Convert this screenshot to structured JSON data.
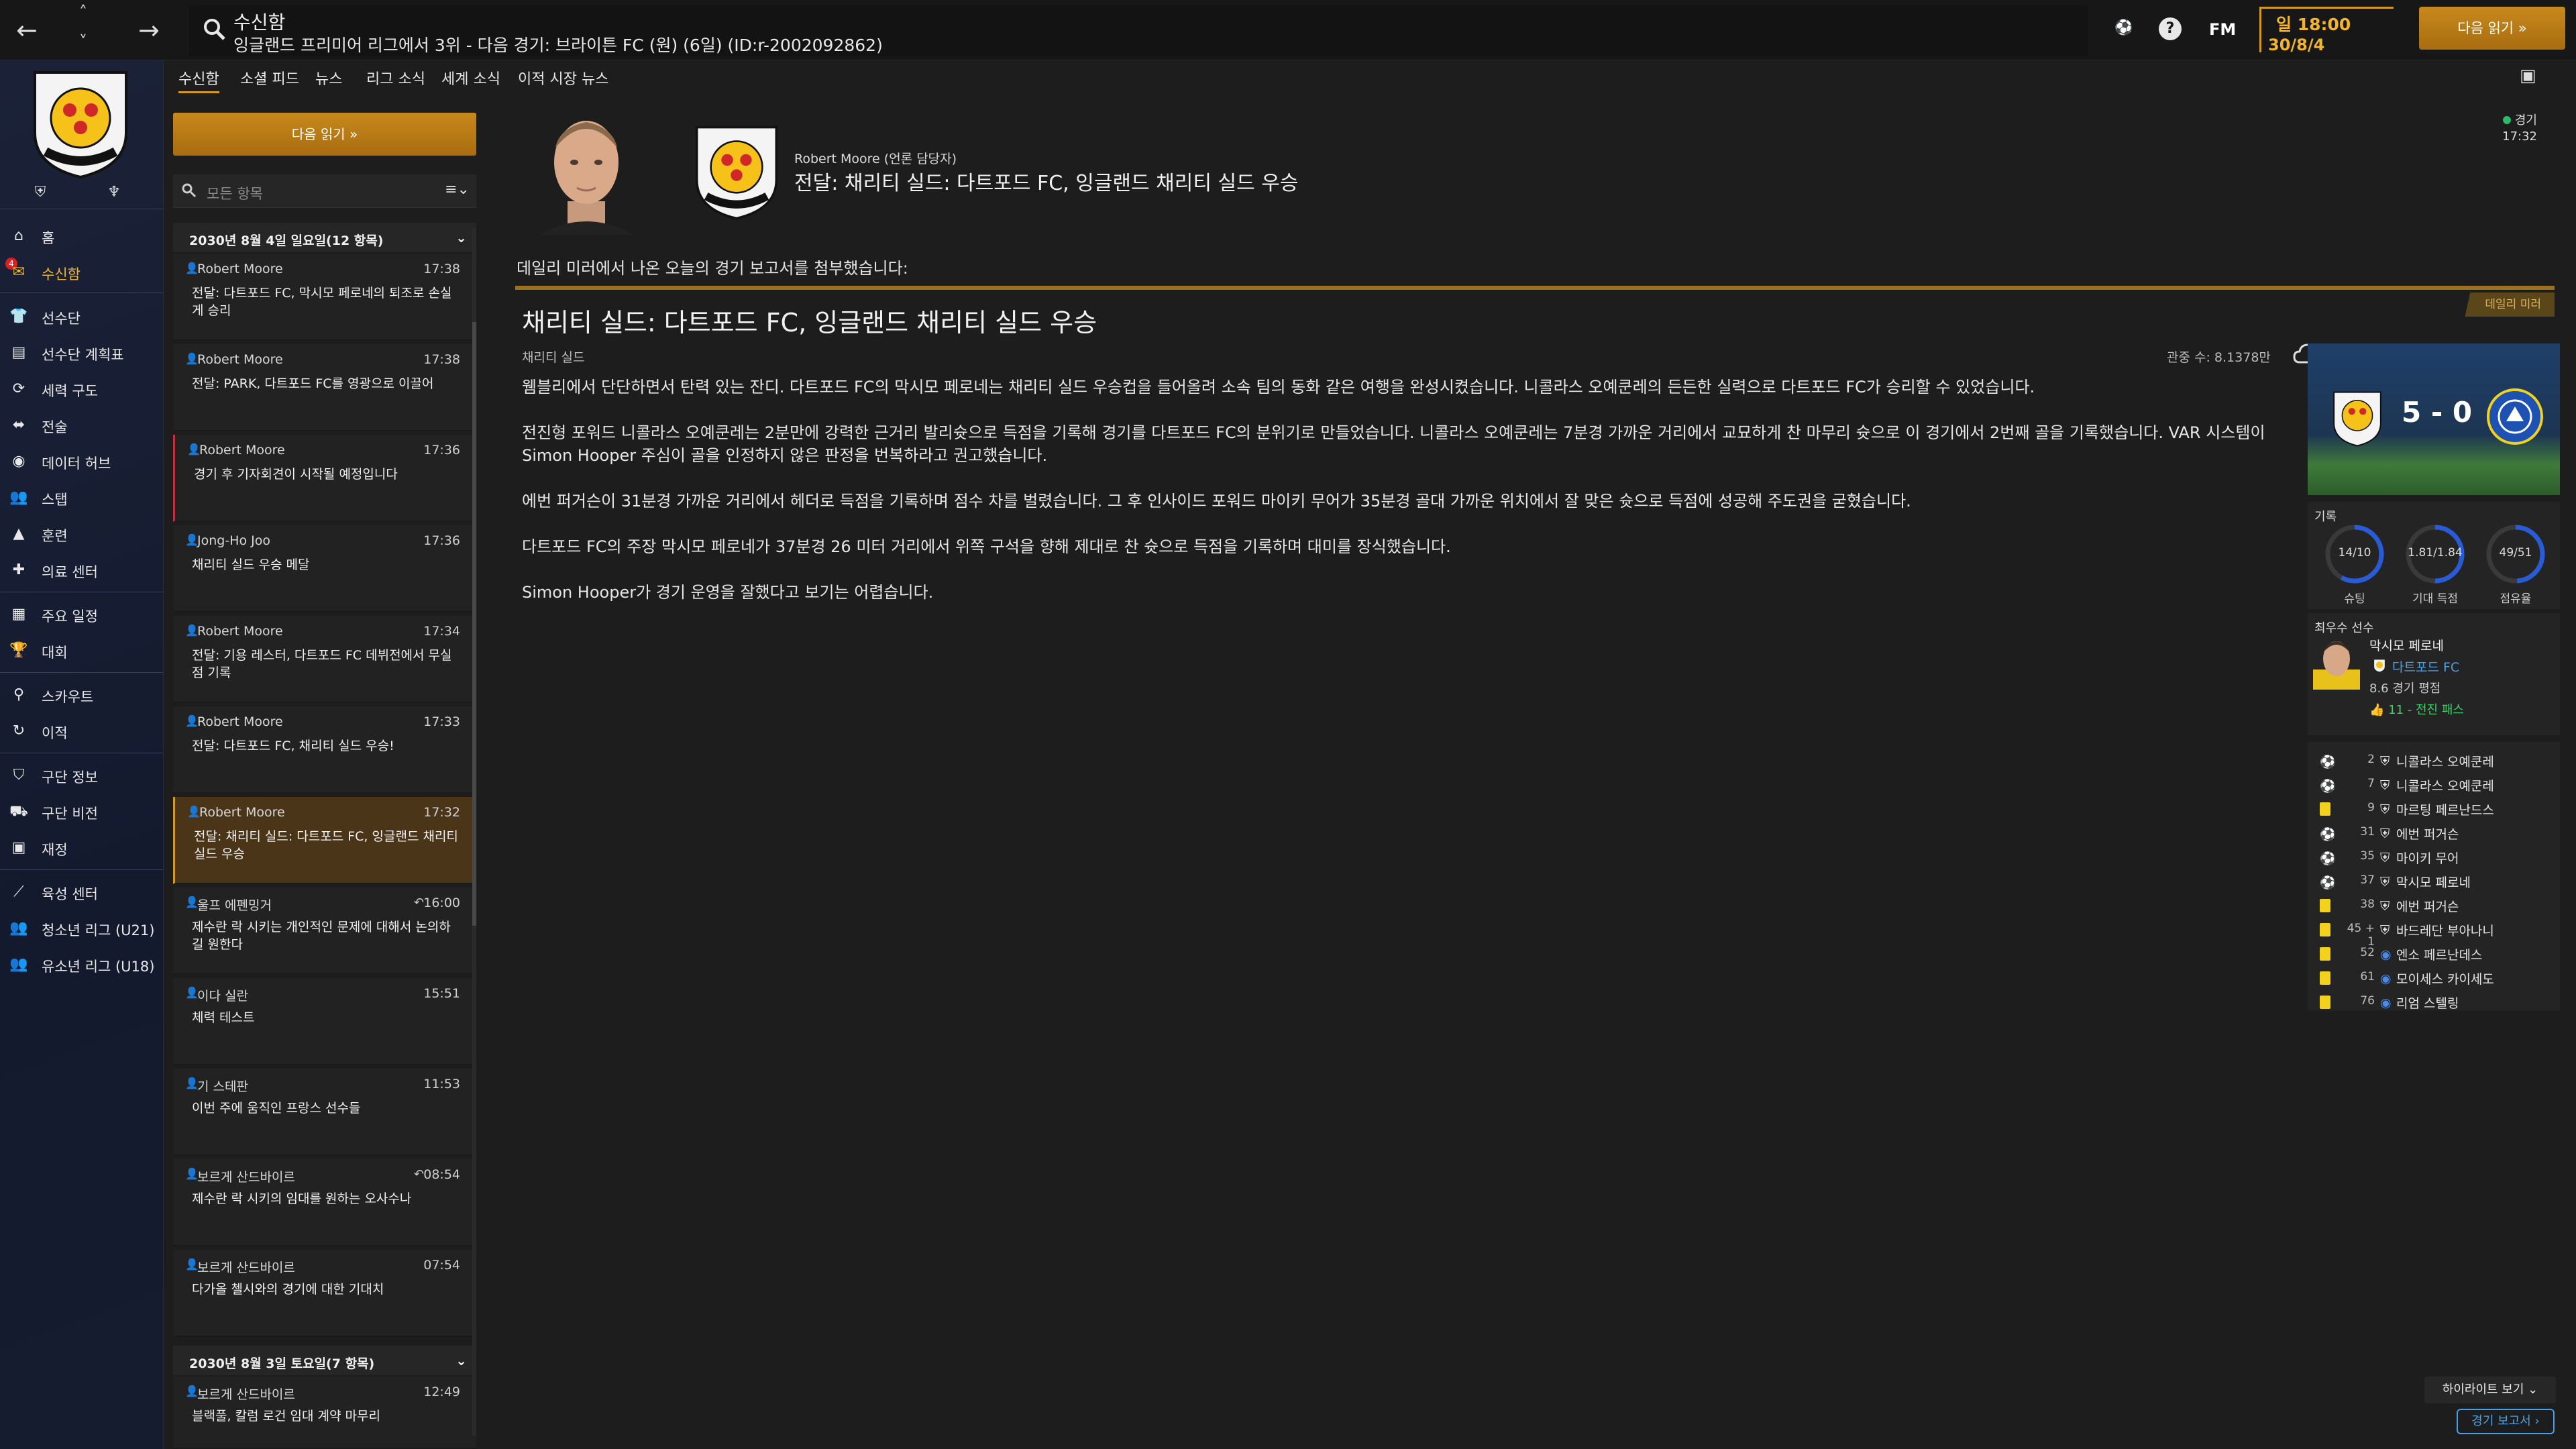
{
  "topbar": {
    "title": "수신함",
    "subtitle": "잉글랜드 프리미어 리그에서 3위 - 다음 경기: 브라이튼 FC (원) (6일) (ID:r-2002092862)",
    "fm_label": "FM",
    "help_label": "?",
    "day_time": "일 18:00",
    "date": "30/8/4",
    "continue_label": "다음 읽기 »"
  },
  "sidebar": {
    "items": [
      {
        "label": "홈",
        "icon": "home-icon"
      },
      {
        "label": "수신함",
        "icon": "inbox-icon",
        "badge": "4"
      },
      {
        "label": "선수단",
        "icon": "squad-icon"
      },
      {
        "label": "선수단 계획표",
        "icon": "planner-icon"
      },
      {
        "label": "세력 구도",
        "icon": "dynamics-icon"
      },
      {
        "label": "전술",
        "icon": "tactics-icon"
      },
      {
        "label": "데이터 허브",
        "icon": "data-hub-icon"
      },
      {
        "label": "스탭",
        "icon": "staff-icon"
      },
      {
        "label": "훈련",
        "icon": "training-icon"
      },
      {
        "label": "의료 센터",
        "icon": "medical-icon"
      },
      {
        "label": "주요 일정",
        "icon": "schedule-icon"
      },
      {
        "label": "대회",
        "icon": "trophy-icon"
      },
      {
        "label": "스카우트",
        "icon": "scouting-icon"
      },
      {
        "label": "이적",
        "icon": "transfers-icon"
      },
      {
        "label": "구단 정보",
        "icon": "club-info-icon"
      },
      {
        "label": "구단 비전",
        "icon": "club-vision-icon"
      },
      {
        "label": "재정",
        "icon": "finances-icon"
      },
      {
        "label": "육성 센터",
        "icon": "development-icon"
      },
      {
        "label": "청소년 리그 (U21)",
        "icon": "u21-icon"
      },
      {
        "label": "유소년 리그 (U18)",
        "icon": "u18-icon"
      }
    ]
  },
  "tabs": [
    "수신함",
    "소셜 피드",
    "뉴스",
    "리그 소식",
    "세계 소식",
    "이적 시장 뉴스"
  ],
  "inbox": {
    "continue_label": "다음 읽기 »",
    "filter_placeholder": "모든 항목",
    "groups": [
      {
        "title": "2030년 8월 4일 일요일(12 항목)"
      },
      {
        "title": "2030년 8월 3일 토요일(7 항목)"
      }
    ],
    "messages": [
      {
        "sender": "Robert Moore",
        "time": "17:38",
        "subject": "전달: 다트포드 FC, 막시모 페로네의 퇴조로 손실게 승리"
      },
      {
        "sender": "Robert Moore",
        "time": "17:38",
        "subject": "전달: PARK, 다트포드 FC를 영광으로 이끌어"
      },
      {
        "sender": "Robert Moore",
        "time": "17:36",
        "subject": "경기 후 기자회견이 시작될 예정입니다"
      },
      {
        "sender": "Jong-Ho Joo",
        "time": "17:36",
        "subject": "채리티 실드 우승 메달"
      },
      {
        "sender": "Robert Moore",
        "time": "17:34",
        "subject": "전달: 기용 레스터, 다트포드 FC 데뷔전에서 무실점 기록"
      },
      {
        "sender": "Robert Moore",
        "time": "17:33",
        "subject": "전달: 다트포드 FC, 채리티 실드 우승!"
      },
      {
        "sender": "Robert Moore",
        "time": "17:32",
        "subject": "전달: 채리티 실드: 다트포드 FC, 잉글랜드 채리티 실드 우승"
      },
      {
        "sender": "울프 에펜밍거",
        "time": "16:00",
        "subject": "제수란 락 시키는 개인적인 문제에 대해서 논의하길 원한다"
      },
      {
        "sender": "이다 실란",
        "time": "15:51",
        "subject": "체력 테스트"
      },
      {
        "sender": "기 스테판",
        "time": "11:53",
        "subject": "이번 주에 움직인 프랑스 선수들"
      },
      {
        "sender": "보르게 산드바이르",
        "time": "08:54",
        "subject": "제수란 락 시키의 임대를 원하는 오사수나"
      },
      {
        "sender": "보르게 산드바이르",
        "time": "07:54",
        "subject": "다가올 첼시와의 경기에 대한 기대치"
      },
      {
        "sender": "보르게 산드바이르",
        "time": "12:49",
        "subject": "블랙풀, 칼럼 로건 임대 계약 마무리"
      }
    ]
  },
  "message": {
    "from": "Robert Moore (언론 담당자)",
    "title": "전달: 채리티 실드: 다트포드 FC, 잉글랜드 채리티 실드 우승",
    "unread_label": "경기",
    "unread_time": "17:32",
    "intro": "데일리 미러에서 나온 오늘의 경기 보고서를 첨부했습니다:",
    "report": {
      "source_badge": "데일리 미러",
      "headline": "채리티 실드: 다트포드 FC, 잉글랜드 채리티 실드 우승",
      "category": "채리티 실드",
      "attendance": "관중 수: 8.1378만",
      "paragraphs": [
        "웸블리에서 단단하면서 탄력 있는 잔디. 다트포드 FC의 막시모 페로네는 채리티 실드 우승컵을 들어올려 소속 팀의 동화 같은 여행을 완성시켰습니다. 니콜라스 오예쿤레의 든든한 실력으로 다트포드 FC가 승리할 수 있었습니다.",
        "전진형 포워드 니콜라스 오예쿤레는 2분만에 강력한 근거리 발리슛으로 득점을 기록해 경기를 다트포드 FC의 분위기로 만들었습니다. 니콜라스 오예쿤레는 7분경 가까운 거리에서 교묘하게 찬 마무리 슛으로 이 경기에서 2번째 골을 기록했습니다. VAR 시스템이 Simon Hooper 주심이 골을 인정하지 않은 판정을 번복하라고 권고했습니다.",
        "에번 퍼거슨이 31분경 가까운 거리에서 헤더로 득점을 기록하며 점수 차를 벌렸습니다. 그 후 인사이드 포워드 마이키 무어가 35분경 골대 가까운 위치에서 잘 맞은 슛으로 득점에 성공해 주도권을 굳혔습니다.",
        "다트포드 FC의 주장 막시모 페로네가 37분경 26 미터 거리에서 위쪽 구석을 향해 제대로 찬 슛으로 득점을 기록하며 대미를 장식했습니다.",
        "Simon Hooper가 경기 운영을 잘했다고 보기는 어렵습니다."
      ]
    }
  },
  "match_panel": {
    "score": "5 - 0",
    "stats_label": "기록",
    "gauges": [
      {
        "value": "14/10",
        "caption": "슈팅",
        "fill": 0.58
      },
      {
        "value": "1.81/1.84",
        "caption": "기대 득점",
        "fill": 0.5
      },
      {
        "value": "49/51",
        "caption": "점유율",
        "fill": 0.49
      }
    ],
    "best_label": "최우수 선수",
    "best_player": "막시모 페로네",
    "best_club": "다트포드 FC",
    "best_rating": "8.6 경기 평점",
    "best_pass": "11 - 전진 패스",
    "events": [
      {
        "min": "2",
        "name": "니콜라스 오예쿤레",
        "type": "goal",
        "team": "home"
      },
      {
        "min": "7",
        "name": "니콜라스 오예쿤레",
        "type": "goal",
        "team": "home"
      },
      {
        "min": "9",
        "name": "마르팅 페르난드스",
        "type": "yellow",
        "team": "home"
      },
      {
        "min": "31",
        "name": "에번 퍼거슨",
        "type": "goal",
        "team": "home"
      },
      {
        "min": "35",
        "name": "마이키 무어",
        "type": "goal",
        "team": "home"
      },
      {
        "min": "37",
        "name": "막시모 페로네",
        "type": "goal",
        "team": "home"
      },
      {
        "min": "38",
        "name": "에번 퍼거슨",
        "type": "yellow",
        "team": "home"
      },
      {
        "min": "45 + 1",
        "name": "바드레단 부아나니",
        "type": "yellow",
        "team": "home"
      },
      {
        "min": "52",
        "name": "엔소 페르난데스",
        "type": "yellow",
        "team": "away"
      },
      {
        "min": "61",
        "name": "모이세스 카이세도",
        "type": "yellow",
        "team": "away"
      },
      {
        "min": "76",
        "name": "리엄 스텔링",
        "type": "yellow",
        "team": "away"
      }
    ]
  },
  "footer": {
    "highlights_label": "하이라이트 보기 ⌄",
    "match_report_label": "경기 보고서 ›"
  },
  "colors": {
    "accent": "#d39a1c",
    "sidebar_bg": "#161c30",
    "link_blue": "#4aa0e6",
    "positive_green": "#3fce6a"
  }
}
